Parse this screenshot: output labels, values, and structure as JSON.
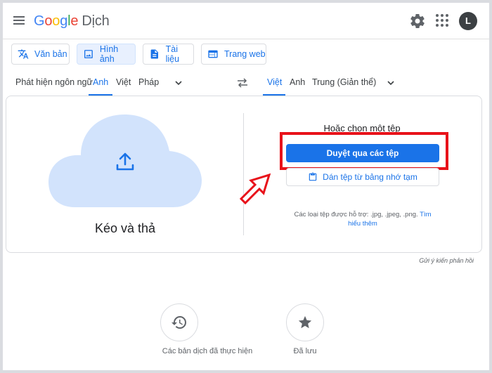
{
  "header": {
    "logo": {
      "g1": "G",
      "o1": "o",
      "o2": "o",
      "g2": "g",
      "l": "l",
      "e": "e",
      "product": "Dịch"
    },
    "avatar_letter": "L"
  },
  "mode_tabs": [
    {
      "label": "Văn bản",
      "icon": "translate-icon"
    },
    {
      "label": "Hình ảnh",
      "icon": "image-icon"
    },
    {
      "label": "Tài liệu",
      "icon": "document-icon"
    },
    {
      "label": "Trang web",
      "icon": "web-icon"
    }
  ],
  "source_langs": [
    "Phát hiện ngôn ngữ",
    "Anh",
    "Việt",
    "Pháp"
  ],
  "target_langs": [
    "Việt",
    "Anh",
    "Trung (Giản thể)"
  ],
  "upload": {
    "drag_label": "Kéo và thả",
    "choose_label": "Hoặc chọn một tệp",
    "browse_label": "Duyệt qua các tệp",
    "paste_label": "Dán tệp từ bảng nhớ tạm",
    "supported_text": "Các loại tệp được hỗ trợ: .jpg, .jpeg, .png.",
    "learn_more": "Tìm hiểu thêm"
  },
  "feedback": "Gửi ý kiến phản hồi",
  "bottom": {
    "history_label": "Các bản dịch đã thực hiện",
    "saved_label": "Đã lưu"
  },
  "colors": {
    "accent": "#1a73e8",
    "highlight_red": "#e8121a",
    "cloud": "#d2e3fc"
  }
}
